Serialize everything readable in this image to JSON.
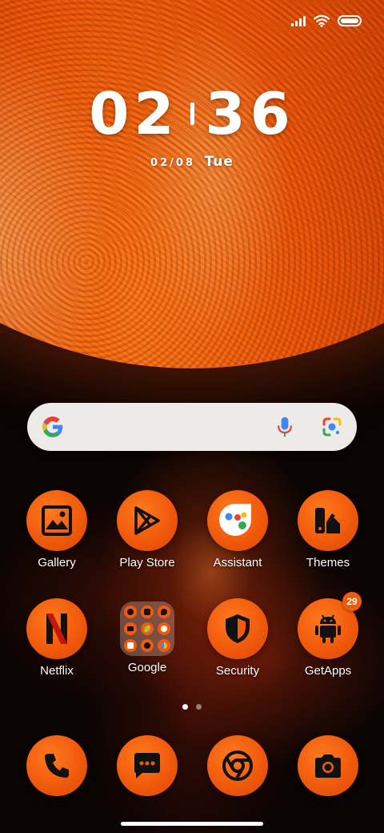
{
  "status_bar": {
    "signal_icon": "signal-bars-icon",
    "wifi_icon": "wifi-icon",
    "battery_icon": "battery-icon",
    "battery_level": 1.0
  },
  "lock_clock": {
    "hours": "02",
    "minutes": "36",
    "date": "02/08",
    "weekday": "Tue"
  },
  "search_bar": {
    "logo": "google-g-icon",
    "voice_icon": "mic-icon",
    "lens_icon": "google-lens-icon",
    "colors": {
      "bar": "#ecebe9",
      "blue": "#4285f4",
      "red": "#ea4335",
      "yellow": "#fbbc05",
      "green": "#34a853"
    }
  },
  "apps": [
    {
      "label": "Gallery",
      "icon": "gallery-icon"
    },
    {
      "label": "Play Store",
      "icon": "play-store-icon"
    },
    {
      "label": "Assistant",
      "icon": "assistant-icon"
    },
    {
      "label": "Themes",
      "icon": "themes-icon"
    },
    {
      "label": "Netflix",
      "icon": "netflix-icon"
    },
    {
      "label": "Google",
      "icon": "folder-icon"
    },
    {
      "label": "Security",
      "icon": "shield-icon"
    },
    {
      "label": "GetApps",
      "icon": "android-icon",
      "badge": "29"
    }
  ],
  "page_indicator": {
    "pages": 2,
    "current": 1
  },
  "dock": [
    {
      "icon": "phone-icon"
    },
    {
      "icon": "messages-icon"
    },
    {
      "icon": "chrome-icon"
    },
    {
      "icon": "camera-icon"
    }
  ],
  "theme": {
    "accent": "#f15a0c",
    "label_color": "#ffffff"
  }
}
